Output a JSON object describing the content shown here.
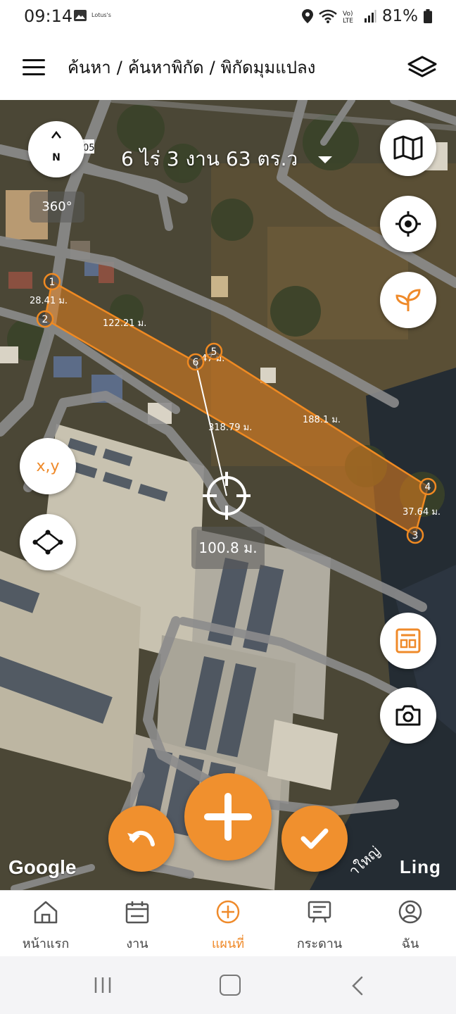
{
  "status_bar": {
    "time": "09:14",
    "notification_label": "Lotus's",
    "battery_percent": "81%"
  },
  "header": {
    "breadcrumb": [
      "ค้นหา",
      "ค้นหาพิกัด",
      "พิกัดมุมแปลง"
    ],
    "separator": "/"
  },
  "map": {
    "area_summary": "6 ไร่ 3 งาน 63 ตร.ว",
    "compass_label": "N",
    "rotation_label": "360°",
    "road_sign": "05",
    "xy_button_label": "x,y",
    "measurement_label": "100.8 ม.",
    "google_logo": "Google",
    "place_name": "Ling",
    "road_name": "าใหญ่",
    "vertices": [
      "1",
      "2",
      "3",
      "4",
      "5",
      "6"
    ],
    "edge_labels": {
      "e12": "28.41 ม.",
      "e26": "122.21 ม.",
      "e65": "47 ม.",
      "e54": "188.1 ม.",
      "e43": "37.64 ม.",
      "e6_center": "318.79 ม."
    },
    "polygon_fill": "#e8821e",
    "accent": "#f0902e"
  },
  "bottom_nav": {
    "items": [
      {
        "label": "หน้าแรก",
        "icon": "home-icon"
      },
      {
        "label": "งาน",
        "icon": "calendar-icon"
      },
      {
        "label": "แผนที่",
        "icon": "plus-circle-icon"
      },
      {
        "label": "กระดาน",
        "icon": "board-icon"
      },
      {
        "label": "ฉัน",
        "icon": "user-icon"
      }
    ],
    "active_index": 2
  }
}
